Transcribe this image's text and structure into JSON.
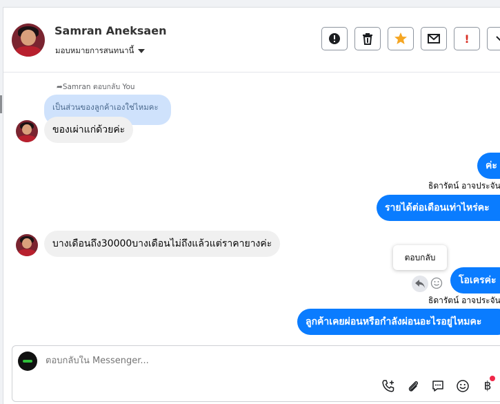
{
  "header": {
    "contact_name": "Samran Aneksaen",
    "assign_label": "มอบหมายการสนทนานี้",
    "buttons": [
      {
        "icon": "alert-circle-icon",
        "label": ""
      },
      {
        "icon": "trash-icon",
        "label": ""
      },
      {
        "icon": "star-icon",
        "label": ""
      },
      {
        "icon": "envelope-icon",
        "label": ""
      },
      {
        "icon": "exclamation-icon",
        "label": "!"
      },
      {
        "icon": "chevron-down-icon",
        "label": ""
      }
    ]
  },
  "conversation": {
    "reply_note": "Samran ตอบกลับ You",
    "quoted_text": "เป็นส่วนของลูกค้าเองใช่ไหมคะ",
    "messages": [
      {
        "direction": "in",
        "text": "ของเผ่าแก่ด้วยค่ะ"
      },
      {
        "direction": "out",
        "text": "ค่ะ"
      },
      {
        "direction": "out",
        "sender": "ธิดารัตน์ อาจประจัน",
        "text": "รายได้ต่อเดือนเท่าไหร่คะ"
      },
      {
        "direction": "in",
        "text": "บางเดือนถึง30000บางเดือนไม่ถึงแล้วแต่ราคายางค่ะ"
      },
      {
        "direction": "out",
        "text": "โอเครค่ะ"
      },
      {
        "direction": "out",
        "sender": "ธิดารัตน์ อาจประจัน",
        "text": "ลูกค้าเคยผ่อนหรือกำลังผ่อนอะไรอยู่ไหมคะ"
      }
    ],
    "tooltip": "ตอบกลับ"
  },
  "composer": {
    "placeholder": "ตอบกลับใน Messenger...",
    "tools": [
      "add-call-icon",
      "paperclip-icon",
      "saved-replies-icon",
      "emoji-icon",
      "baht-icon"
    ]
  },
  "colors": {
    "outgoing_bubble": "#0a7cff",
    "incoming_bubble": "#f0f0f0",
    "quote_bubble": "#cfe2fc",
    "star": "#f5a623",
    "alert_red": "#d93025",
    "notification_dot": "#f02849"
  }
}
